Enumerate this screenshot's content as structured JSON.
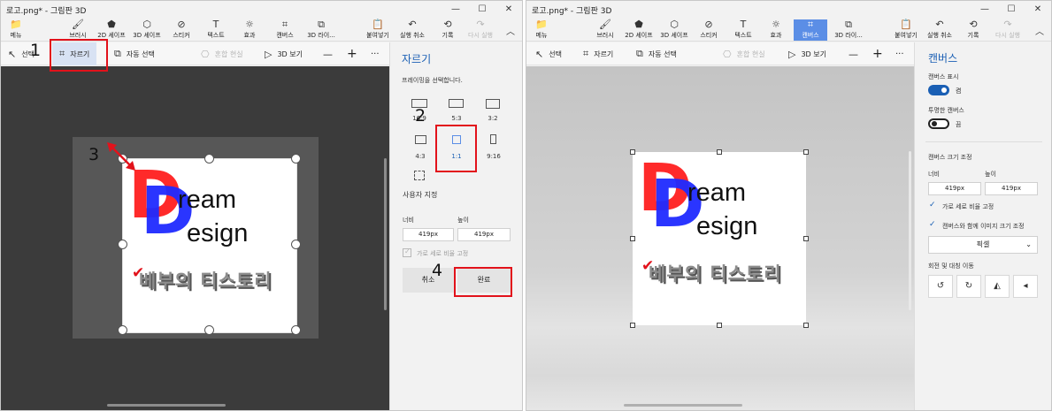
{
  "left": {
    "title": "로고.png* - 그림판 3D",
    "window_controls": [
      "—",
      "☐",
      "✕"
    ],
    "menu": [
      {
        "icon": "📁",
        "label": "메뉴"
      },
      {
        "icon": "🖌",
        "label": "브러시"
      },
      {
        "icon": "⬟",
        "label": "2D 셰이프"
      },
      {
        "icon": "⬡",
        "label": "3D 셰이프"
      },
      {
        "icon": "⊘",
        "label": "스티커"
      },
      {
        "icon": "T",
        "label": "텍스트"
      },
      {
        "icon": "☼",
        "label": "효과"
      },
      {
        "icon": "⌗",
        "label": "캔버스"
      },
      {
        "icon": "⧉",
        "label": "3D 라이..."
      },
      {
        "icon": "📋",
        "label": "붙여넣기"
      },
      {
        "icon": "↶",
        "label": "실행 취소"
      },
      {
        "icon": "⟲",
        "label": "기록"
      },
      {
        "icon": "↷",
        "label": "다시 실행"
      }
    ],
    "toolbar": {
      "select": "선택",
      "crop": "자르기",
      "magic_select": "자동 선택",
      "mixed_reality": "혼합 현실",
      "view_3d": "3D 보기",
      "zoom_out": "—",
      "zoom_in": "+",
      "more": "···"
    },
    "panel": {
      "title": "자르기",
      "subtitle": "프레이밍을 선택합니다.",
      "ratios": [
        "16:9",
        "5:3",
        "3:2",
        "4:3",
        "1:1",
        "9:16"
      ],
      "custom": "사용자 지정",
      "width_label": "너비",
      "height_label": "높이",
      "width_value": "419px",
      "height_value": "419px",
      "lock_ratio": "가로 세로 비율 고정",
      "cancel": "취소",
      "done": "완료"
    },
    "annotations": [
      "1",
      "2",
      "3",
      "4"
    ],
    "logo": {
      "letter1": "D",
      "letter2": "D",
      "line1": "ream",
      "line2": "esign",
      "korean": "베부의 티스토리",
      "check": "✔"
    }
  },
  "right": {
    "title": "로고.png* - 그림판 3D",
    "window_controls": [
      "—",
      "☐",
      "✕"
    ],
    "menu": [
      {
        "icon": "📁",
        "label": "메뉴"
      },
      {
        "icon": "🖌",
        "label": "브러시"
      },
      {
        "icon": "⬟",
        "label": "2D 셰이프"
      },
      {
        "icon": "⬡",
        "label": "3D 셰이프"
      },
      {
        "icon": "⊘",
        "label": "스티커"
      },
      {
        "icon": "T",
        "label": "텍스트"
      },
      {
        "icon": "☼",
        "label": "효과"
      },
      {
        "icon": "⌗",
        "label": "캔버스"
      },
      {
        "icon": "⧉",
        "label": "3D 라이..."
      },
      {
        "icon": "📋",
        "label": "붙여넣기"
      },
      {
        "icon": "↶",
        "label": "실행 취소"
      },
      {
        "icon": "⟲",
        "label": "기록"
      },
      {
        "icon": "↷",
        "label": "다시 실행"
      }
    ],
    "toolbar": {
      "select": "선택",
      "crop": "자르기",
      "magic_select": "자동 선택",
      "mixed_reality": "혼합 현실",
      "view_3d": "3D 보기",
      "zoom_out": "—",
      "zoom_in": "+",
      "more": "···"
    },
    "panel": {
      "title": "캔버스",
      "show_canvas": "캔버스 표시",
      "show_canvas_state": "켬",
      "transparent": "투명한 캔버스",
      "transparent_state": "끔",
      "resize_title": "캔버스 크기 조정",
      "width_label": "너비",
      "height_label": "높이",
      "width_value": "419px",
      "height_value": "419px",
      "lock_ratio": "가로 세로 비율 고정",
      "resize_with_image": "캔버스와 함께 이미지 크기 조정",
      "unit": "픽셀",
      "rotate_title": "회전 및 대칭 이동",
      "rotate_icons": [
        "↺",
        "↻",
        "◭",
        "◂"
      ]
    },
    "logo": {
      "letter1": "D",
      "letter2": "D",
      "line1": "ream",
      "line2": "esign",
      "korean": "베부의 티스토리",
      "check": "✔"
    }
  },
  "colors": {
    "annotation_red": "#e2121b",
    "accent_blue": "#1a5fb4",
    "logo_red": "#ff1f1f",
    "logo_blue": "#1f2bff"
  }
}
